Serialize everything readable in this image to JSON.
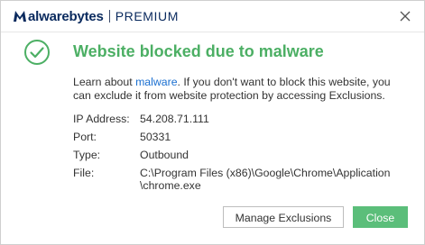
{
  "brand": {
    "name": "Malwarebytes",
    "name_bold": "alwarebytes",
    "tier": "PREMIUM"
  },
  "colors": {
    "accent_green": "#4caf64",
    "button_green": "#5bbe7a",
    "link_blue": "#1a6fd0",
    "brand_navy": "#0a2a5e"
  },
  "dialog": {
    "headline": "Website blocked due to malware",
    "message_before": "Learn about ",
    "message_link": "malware",
    "message_after": ". If you don't want to block this website, you can exclude it from website protection by accessing Exclusions.",
    "details": [
      {
        "label": "IP Address:",
        "value": "54.208.71.111"
      },
      {
        "label": "Port:",
        "value": "50331"
      },
      {
        "label": "Type:",
        "value": "Outbound"
      }
    ],
    "file": {
      "label": "File:",
      "line1": "C:\\Program Files (x86)\\Google\\Chrome\\Application",
      "line2": "\\chrome.exe"
    },
    "buttons": {
      "manage": "Manage Exclusions",
      "close": "Close"
    }
  },
  "icons": {
    "status": "checkmark-circle-icon",
    "close": "close-icon",
    "logo": "malwarebytes-logo-icon"
  }
}
